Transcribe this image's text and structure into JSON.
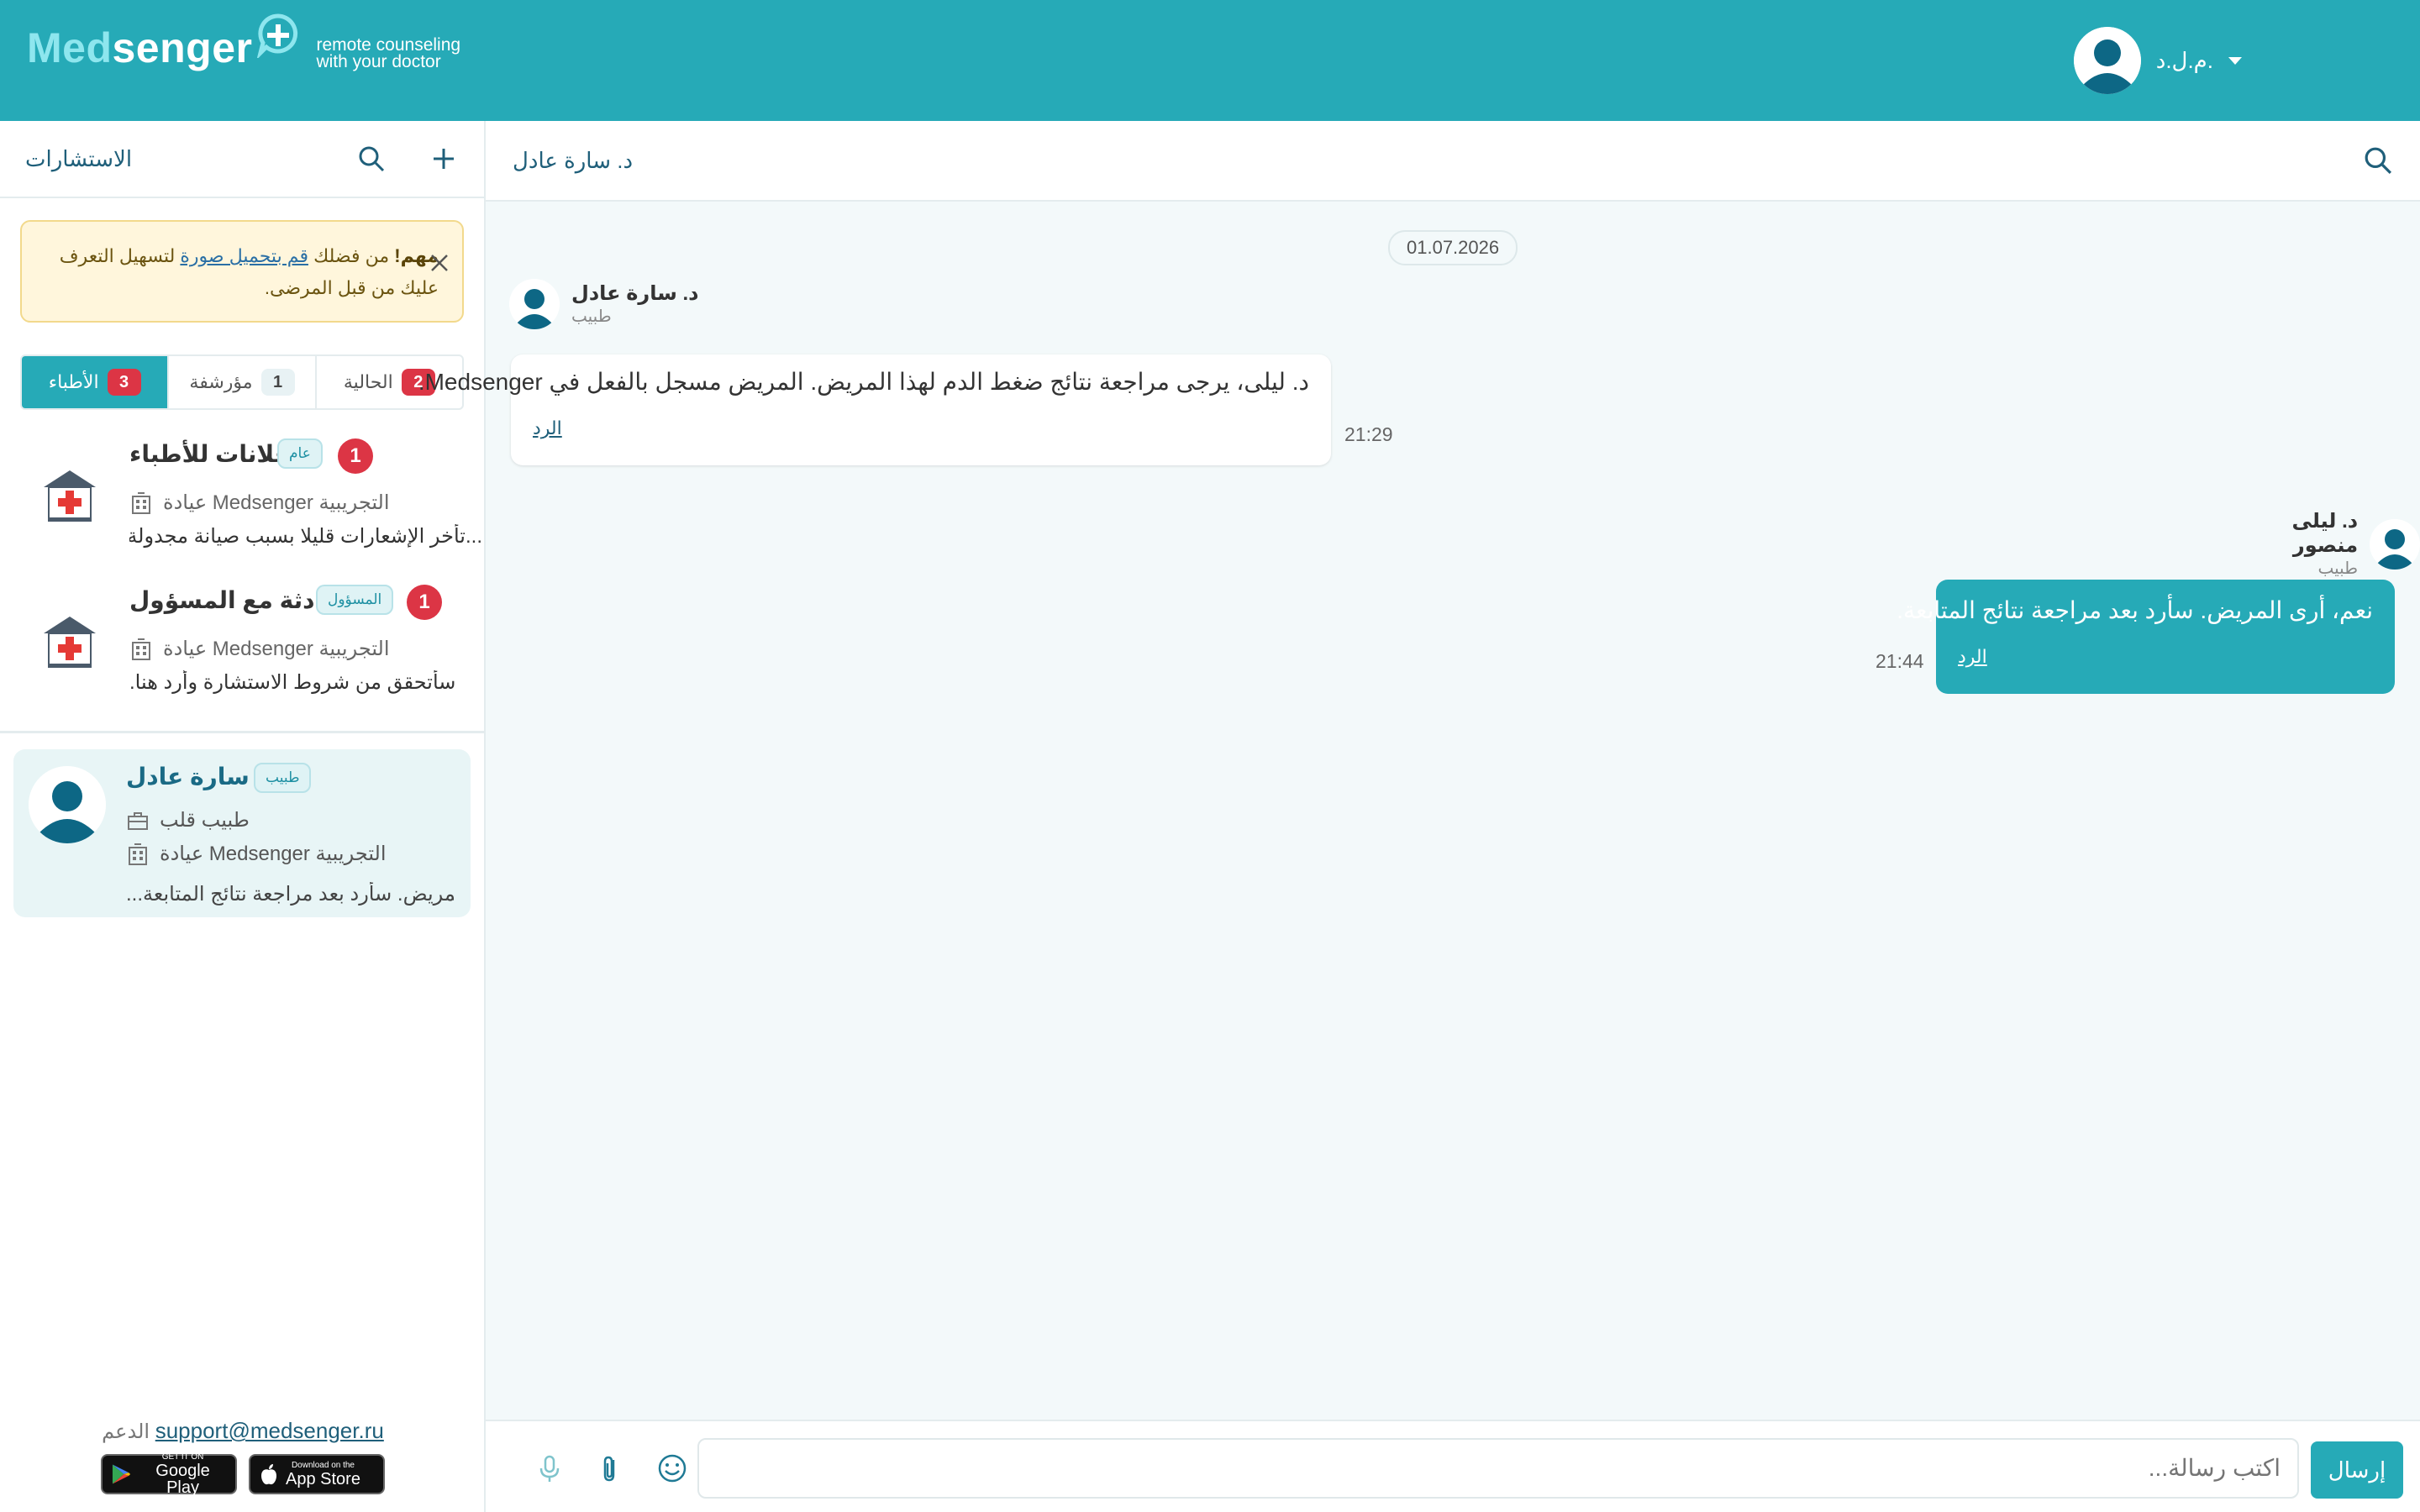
{
  "colors": {
    "brand": "#26aab7",
    "alert_bg": "#fff6dc",
    "badge_red": "#dc3545",
    "selected_bg": "#e8f5f6"
  },
  "header": {
    "logo_prefix": "Med",
    "logo_suffix": "senger",
    "tagline_line1": "remote counseling",
    "tagline_line2": "with your doctor",
    "user_name": "م.ل.د."
  },
  "sidebar": {
    "title": "الاستشارات",
    "alert": {
      "important": "مهم!",
      "text1": " من فضلك ",
      "link1": "قم بتحميل صورة",
      "text2": " لتسهيل التعرف عليك من قبل المرضى."
    },
    "tabs": [
      {
        "label": "الأطباء",
        "count": "3"
      },
      {
        "label": "مؤرشفة",
        "count": "1"
      },
      {
        "label": "الحالية",
        "count": "2"
      }
    ],
    "conversations": [
      {
        "name": "إعلانات للأطباء",
        "tag": "عام",
        "unread": "1",
        "clinic": "عيادة Medsenger التجريبية",
        "preview": "...تأخر الإشعارات قليلا بسبب صيانة مجدولة"
      },
      {
        "name": "محادثة مع المسؤول",
        "tag": "المسؤول",
        "unread": "1",
        "clinic": "عيادة Medsenger التجريبية",
        "preview": "سأتحقق من شروط الاستشارة وأرد هنا."
      }
    ],
    "selected": {
      "name": "د. سارة عادل",
      "tag": "طبيب",
      "specialty": "طبيب قلب",
      "clinic": "عيادة Medsenger التجريبية",
      "preview": "...المريض. سأرد بعد مراجعة نتائج المتابعة"
    },
    "footer": {
      "support_label": "الدعم",
      "support_email": "support@medsenger.ru",
      "google_small": "GET IT ON",
      "google_big": "Google Play",
      "apple_small": "Download on the",
      "apple_big": "App Store"
    }
  },
  "chat": {
    "title": "د. سارة عادل",
    "date": "01.07.2026",
    "messages": [
      {
        "sender": "د. سارة عادل",
        "role": "طبيب",
        "text": "د. ليلى، يرجى مراجعة نتائج ضغط الدم لهذا المريض. المريض مسجل بالفعل في Medsenger.",
        "reply": "الرد",
        "time": "21:29"
      },
      {
        "sender": "د. ليلى منصور",
        "role": "طبيب",
        "text": "نعم، أرى المريض. سأرد بعد مراجعة نتائج المتابعة.",
        "reply": "الرد",
        "time": "21:44"
      }
    ],
    "composer": {
      "placeholder": "اكتب رسالة...",
      "send_label": "إرسال"
    }
  }
}
